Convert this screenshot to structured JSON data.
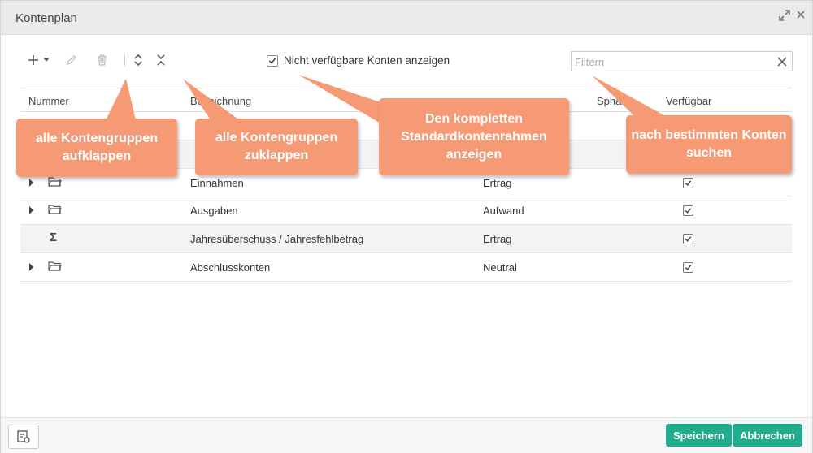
{
  "window": {
    "title": "Kontenplan"
  },
  "toolbar": {
    "add_icon": "plus-icon",
    "dropdown_icon": "caret-down-icon",
    "edit_icon": "pencil-icon",
    "delete_icon": "trash-icon",
    "expand_all_icon": "expand-all-icon",
    "collapse_all_icon": "collapse-all-icon",
    "show_unavailable_label": "Nicht verfügbare Konten anzeigen",
    "show_unavailable_checked": true,
    "filter_placeholder": "Filtern",
    "filter_value": ""
  },
  "grid": {
    "columns": [
      "Nummer",
      "Bezeichnung",
      "Sphäre",
      "Verfügbar"
    ],
    "visible_rows": [
      {
        "icon": "folder",
        "expandable": true,
        "name": "Einnahmen",
        "sphere": "Ertrag",
        "available": true
      },
      {
        "icon": "folder",
        "expandable": true,
        "name": "Ausgaben",
        "sphere": "Aufwand",
        "available": true
      },
      {
        "icon": "sigma",
        "expandable": false,
        "name": "Jahresüberschuss / Jahresfehlbetrag",
        "sphere": "Ertrag",
        "available": true
      },
      {
        "icon": "folder",
        "expandable": true,
        "name": "Abschlusskonten",
        "sphere": "Neutral",
        "available": true
      }
    ]
  },
  "callouts": {
    "expand": "alle Kontengruppen aufklappen",
    "collapse": "alle Kontengruppen zuklappen",
    "standard": "Den kompletten Standardkontenrahmen anzeigen",
    "search": "nach bestimmten Konten suchen"
  },
  "footer": {
    "save_label": "Speichern",
    "cancel_label": "Abbrechen"
  },
  "colors": {
    "accent": "#1fad8e",
    "callout": "#f59a74"
  }
}
